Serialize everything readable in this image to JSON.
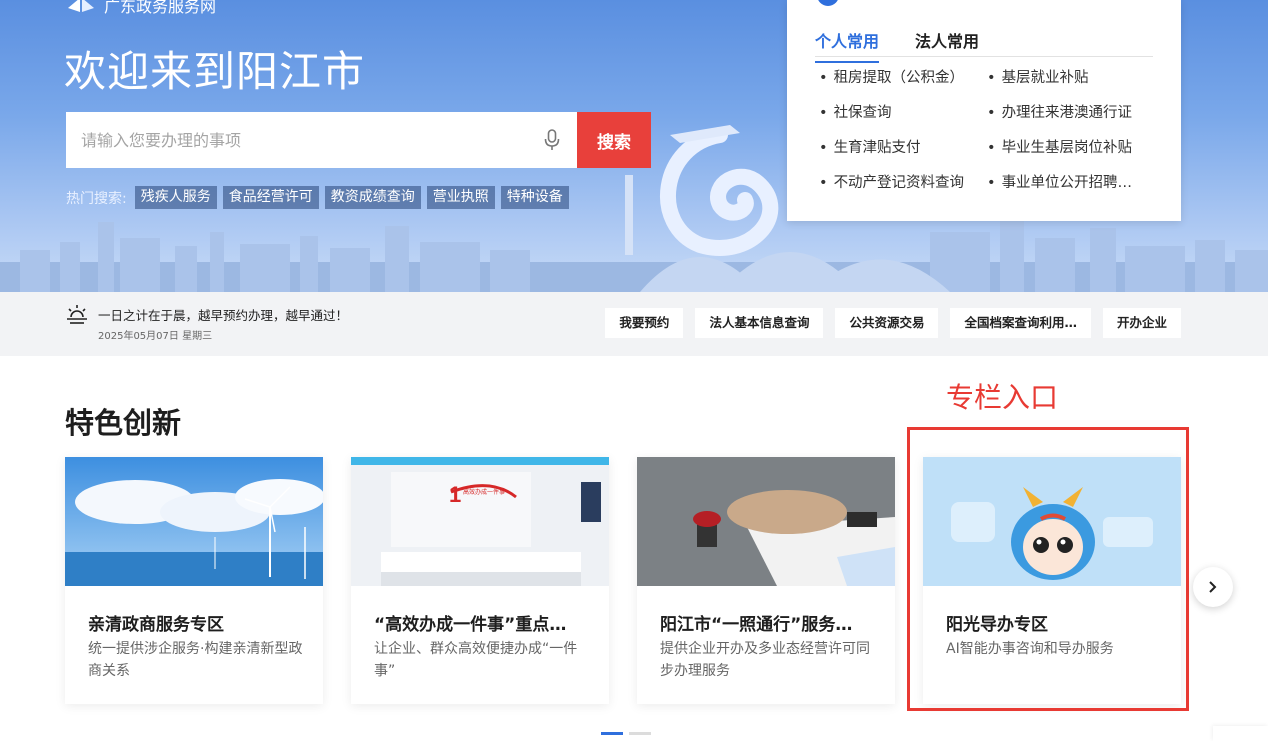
{
  "header": {
    "brand": "广东政务服务网",
    "welcome": "欢迎来到阳江市"
  },
  "search": {
    "placeholder": "请输入您要办理的事项",
    "button_label": "搜索",
    "hot_label": "热门搜索:",
    "hot_tags": [
      "残疾人服务",
      "食品经营许可",
      "教资成绩查询",
      "营业执照",
      "特种设备"
    ]
  },
  "quick_panel": {
    "tabs": [
      "个人常用",
      "法人常用"
    ],
    "active_tab": "个人常用",
    "items": [
      "租房提取（公积金）",
      "基层就业补贴",
      "社保查询",
      "办理往来港澳通行证",
      "生育津贴支付",
      "毕业生基层岗位补贴",
      "不动产登记资料查询",
      "事业单位公开招聘…"
    ]
  },
  "notice": {
    "text": "一日之计在于晨，越早预约办理，越早通过！",
    "date": "2025年05月07日 星期三",
    "buttons": [
      "我要预约",
      "法人基本信息查询",
      "公共资源交易",
      "全国档案查询利用…",
      "开办企业"
    ]
  },
  "featured": {
    "title": "特色创新",
    "annotation": "专栏入口",
    "cards": [
      {
        "title": "亲清政商服务专区",
        "desc": "统一提供涉企服务·构建亲清新型政商关系"
      },
      {
        "title": "“高效办成一件事”重点…",
        "desc": "让企业、群众高效便捷办成“一件事”"
      },
      {
        "title": "阳江市“一照通行”服务…",
        "desc": "提供企业开办及多业态经营许可同步办理服务"
      },
      {
        "title": "阳光导办专区",
        "desc": "AI智能办事咨询和导办服务"
      }
    ],
    "card2_sign": "高效办成一件事"
  },
  "colors": {
    "accent_blue": "#2f6fdd",
    "search_red": "#e8403b",
    "annotation_red": "#e83a33"
  },
  "icons": {
    "mic": "microphone-icon",
    "notice": "sunrise-icon",
    "next": "chevron-right-icon"
  }
}
